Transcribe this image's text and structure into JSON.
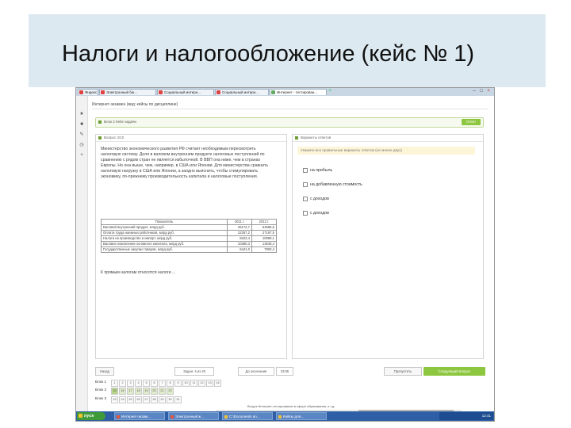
{
  "slide": {
    "title": "Налоги и налогообложение (кейс № 1)"
  },
  "browser": {
    "tabs": [
      {
        "label": "Яндекс"
      },
      {
        "label": "Электронный бю..."
      },
      {
        "label": "Социальный интерн..."
      },
      {
        "label": "Социальный интерн..."
      },
      {
        "label": "Интернет - тестирован..."
      }
    ],
    "new_tab": "+"
  },
  "app": {
    "header": "Интернет-экзамен (вид: кейсы по дисциплине)",
    "block_label": "Блок 2 Кейс-задачи",
    "block_button": "Ответ",
    "left_panel_title": "Вопрос 2/10",
    "question_text": "Министерство экономического развития РФ считает необходимым пересмотреть налоговую систему. Доля в валовом внутреннем продукте налоговых поступлений по сравнению с рядом стран не является избыточной. В ВВП она ниже, чем в странах Европы. Но она выше, чем, например, в США или Японии. Для министерства сравнить налоговую нагрузку в США или Японии, а заодно выяснить, чтобы стимулировать экономику, по-прежнему производительность капитала и налоговые поступления.",
    "table": {
      "headers": [
        "Показатель",
        "2011 г.",
        "2012 г."
      ],
      "rows": [
        [
          "Валовой внутренний продукт, млрд руб.",
          "45172,7",
          "54585,6"
        ],
        [
          "Оплата труда наемных работников, млрд руб.",
          "22357,2",
          "27167,5"
        ],
        [
          "Налоги на производство и импорт, млрд руб.",
          "8222,4",
          "10089,1"
        ],
        [
          "Валовое накопление основного капитала, млрд руб.",
          "10380,3",
          "13648,4"
        ],
        [
          "Государственные закупки товаров, млрд руб.",
          "6441,0",
          "7903,4"
        ]
      ]
    },
    "question_ask": "К прямым налогам относятся налоги ...",
    "right_panel_title": "Варианты ответов",
    "prompt": "Укажите все правильные варианты ответов (не менее двух)",
    "options": [
      "на прибыль",
      "на добавленную стоимость",
      "с доходов",
      "с доходов"
    ],
    "nav": {
      "prev": "Назад",
      "progress": "Задан: 4 из 25",
      "timer": "До окончания",
      "time": "23:55",
      "skip": "Пропустить",
      "next": "Следующий вопрос"
    },
    "blocks": [
      {
        "label": "Блок 1",
        "cells": [
          "1",
          "2",
          "3",
          "4",
          "5",
          "6",
          "7",
          "8",
          "9",
          "10",
          "11",
          "12",
          "13",
          "14"
        ]
      },
      {
        "label": "Блок 2",
        "cells": [
          "15",
          "16",
          "17",
          "18",
          "19",
          "20",
          "21",
          "22"
        ]
      },
      {
        "label": "Блок 3",
        "cells": [
          "23",
          "24",
          "25",
          "26",
          "27",
          "28",
          "29",
          "30",
          "31"
        ]
      }
    ],
    "status": "Вход в Интернет-тестирование в сфере образования, и т.д."
  },
  "taskbar": {
    "start": "пуск",
    "items": [
      {
        "label": "Интернет-экзам..."
      },
      {
        "label": "Электронный ж..."
      },
      {
        "label": "С:\\Documents an..."
      },
      {
        "label": "Кейсы для..."
      }
    ],
    "clock": "12:41"
  },
  "colors": {
    "accent_green": "#8dc63f",
    "title_bg": "#dce9f1",
    "taskbar": "#2e5fa6"
  }
}
